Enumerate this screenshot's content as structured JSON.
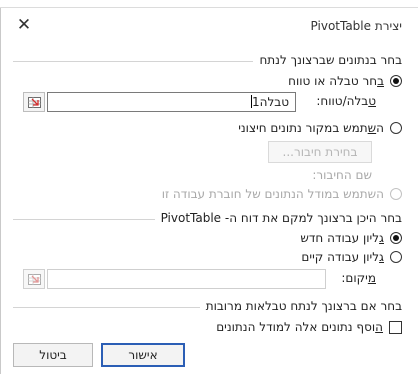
{
  "dialog": {
    "title": "יצירת PivotTable",
    "close_glyph": "✕"
  },
  "data_section": {
    "heading": "בחר בנתונים שברצונך לנתח",
    "option_table": {
      "mnemonic": "ב",
      "rest": "חר טבלה או טווח",
      "checked": true
    },
    "table_range": {
      "mnemonic": "ט",
      "rest": "בלה/טווח:",
      "value": "טבלה1"
    },
    "option_external": {
      "pre": "ה",
      "mnemonic": "ש",
      "rest": "תמש במקור נתונים חיצוני",
      "checked": false
    },
    "choose_connection_button": "בחירת חיבור...",
    "connection_name": "שם החיבור:",
    "option_data_model": {
      "label": "השתמש במודל הנתונים של חוברת עבודה זו",
      "enabled": false
    }
  },
  "location_section": {
    "heading": "בחר היכן ברצונך למקם את דוח ה- PivotTable",
    "option_new": {
      "mnemonic": "ג",
      "rest": "ליון עבודה חדש",
      "checked": true
    },
    "option_existing": {
      "mnemonic": "ג",
      "rest": "ליון עבודה קיים",
      "checked": false
    },
    "location": {
      "mnemonic": "מ",
      "rest": "יקום:",
      "value": ""
    }
  },
  "multi_section": {
    "heading": "בחר אם ברצונך לנתח טבלאות מרובות",
    "add_to_model": {
      "mnemonic": "ה",
      "rest": "וסף נתונים אלה למודל הנתונים",
      "checked": false
    }
  },
  "buttons": {
    "ok": "אישור",
    "cancel": "ביטול"
  },
  "icons": {
    "range_selector": "range-select-icon",
    "close": "close-icon"
  },
  "colors": {
    "ok_border": "#2b5eb5"
  }
}
